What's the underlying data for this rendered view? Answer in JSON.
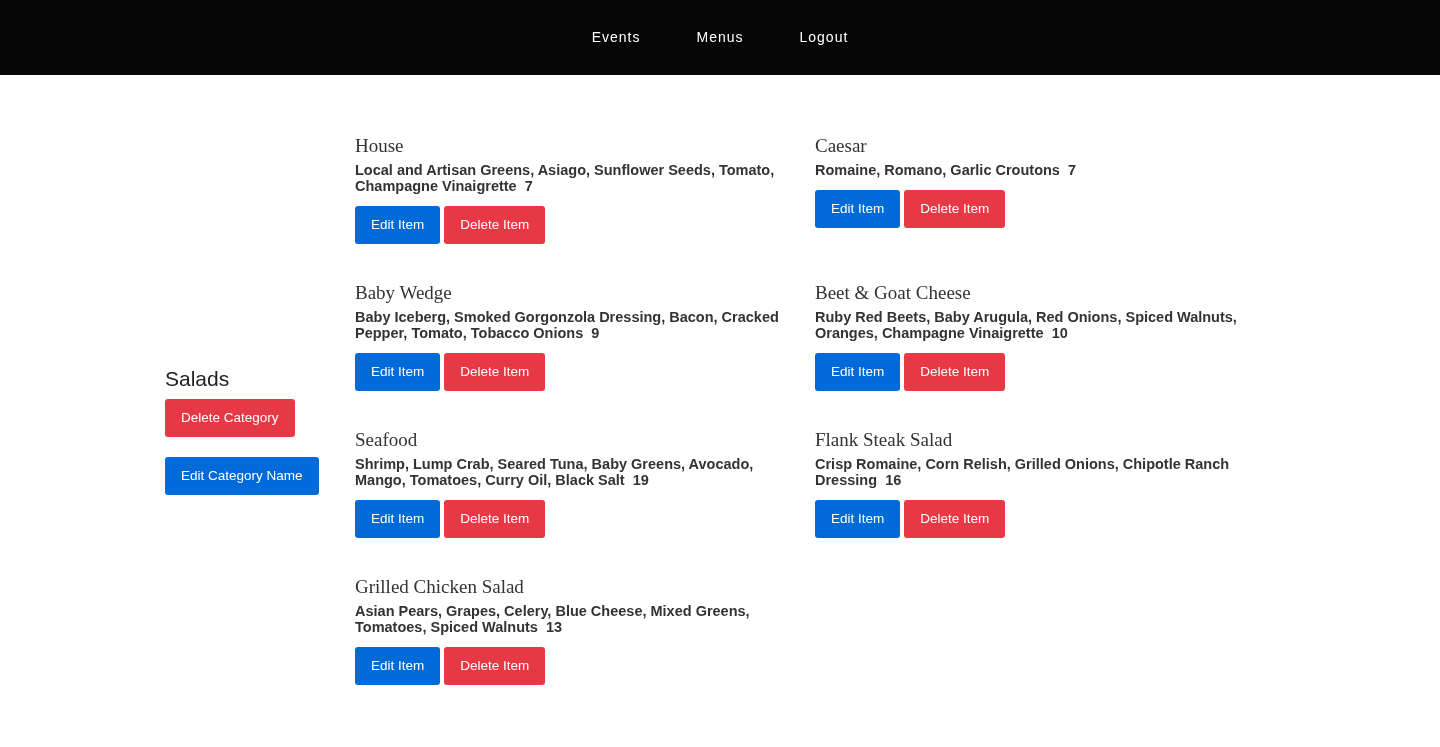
{
  "nav": {
    "links": [
      "Events",
      "Menus",
      "Logout"
    ]
  },
  "category": {
    "name": "Salads",
    "delete_button": "Delete Category",
    "edit_button": "Edit Category Name"
  },
  "items": [
    {
      "title": "House",
      "description": "Local and Artisan Greens, Asiago, Sunflower Seeds, Tomato, Champagne Vinaigrette",
      "price": "7",
      "edit_button": "Edit Item",
      "delete_button": "Delete Item"
    },
    {
      "title": "Caesar",
      "description": "Romaine, Romano, Garlic Croutons",
      "price": "7",
      "edit_button": "Edit Item",
      "delete_button": "Delete Item"
    },
    {
      "title": "Baby Wedge",
      "description": "Baby Iceberg, Smoked Gorgonzola Dressing, Bacon, Cracked Pepper, Tomato, Tobacco Onions",
      "price": "9",
      "edit_button": "Edit Item",
      "delete_button": "Delete Item"
    },
    {
      "title": "Beet & Goat Cheese",
      "description": "Ruby Red Beets, Baby Arugula, Red Onions, Spiced Walnuts, Oranges, Champagne Vinaigrette",
      "price": "10",
      "edit_button": "Edit Item",
      "delete_button": "Delete Item"
    },
    {
      "title": "Seafood",
      "description": "Shrimp, Lump Crab, Seared Tuna, Baby Greens, Avocado, Mango, Tomatoes, Curry Oil, Black Salt",
      "price": "19",
      "edit_button": "Edit Item",
      "delete_button": "Delete Item"
    },
    {
      "title": "Flank Steak Salad",
      "description": "Crisp Romaine, Corn Relish, Grilled Onions, Chipotle Ranch Dressing",
      "price": "16",
      "edit_button": "Edit Item",
      "delete_button": "Delete Item"
    },
    {
      "title": "Grilled Chicken Salad",
      "description": "Asian Pears, Grapes, Celery, Blue Cheese, Mixed Greens, Tomatoes, Spiced Walnuts",
      "price": "13",
      "edit_button": "Edit Item",
      "delete_button": "Delete Item"
    }
  ]
}
